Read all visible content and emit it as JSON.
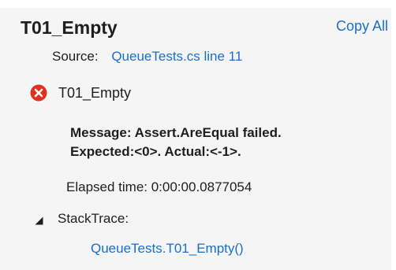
{
  "test": {
    "title": "T01_Empty",
    "copy_all_label": "Copy All",
    "source_label": "Source:",
    "source_link": "QueueTests.cs line 11",
    "result": {
      "status_icon": "error-icon",
      "name": "T01_Empty"
    },
    "message_line1": "Message: Assert.AreEqual failed.",
    "message_line2": "Expected:<0>. Actual:<-1>.",
    "elapsed": "Elapsed time: 0:00:00.0877054",
    "stacktrace": {
      "expander_icon": "triangle-expanded-icon",
      "label": "StackTrace:",
      "frames": [
        "QueueTests.T01_Empty()"
      ]
    }
  },
  "colors": {
    "panel_bg": "#f5f5f5",
    "link": "#1a6fc9",
    "error": "#e0301e",
    "text": "#1e1e1e"
  }
}
